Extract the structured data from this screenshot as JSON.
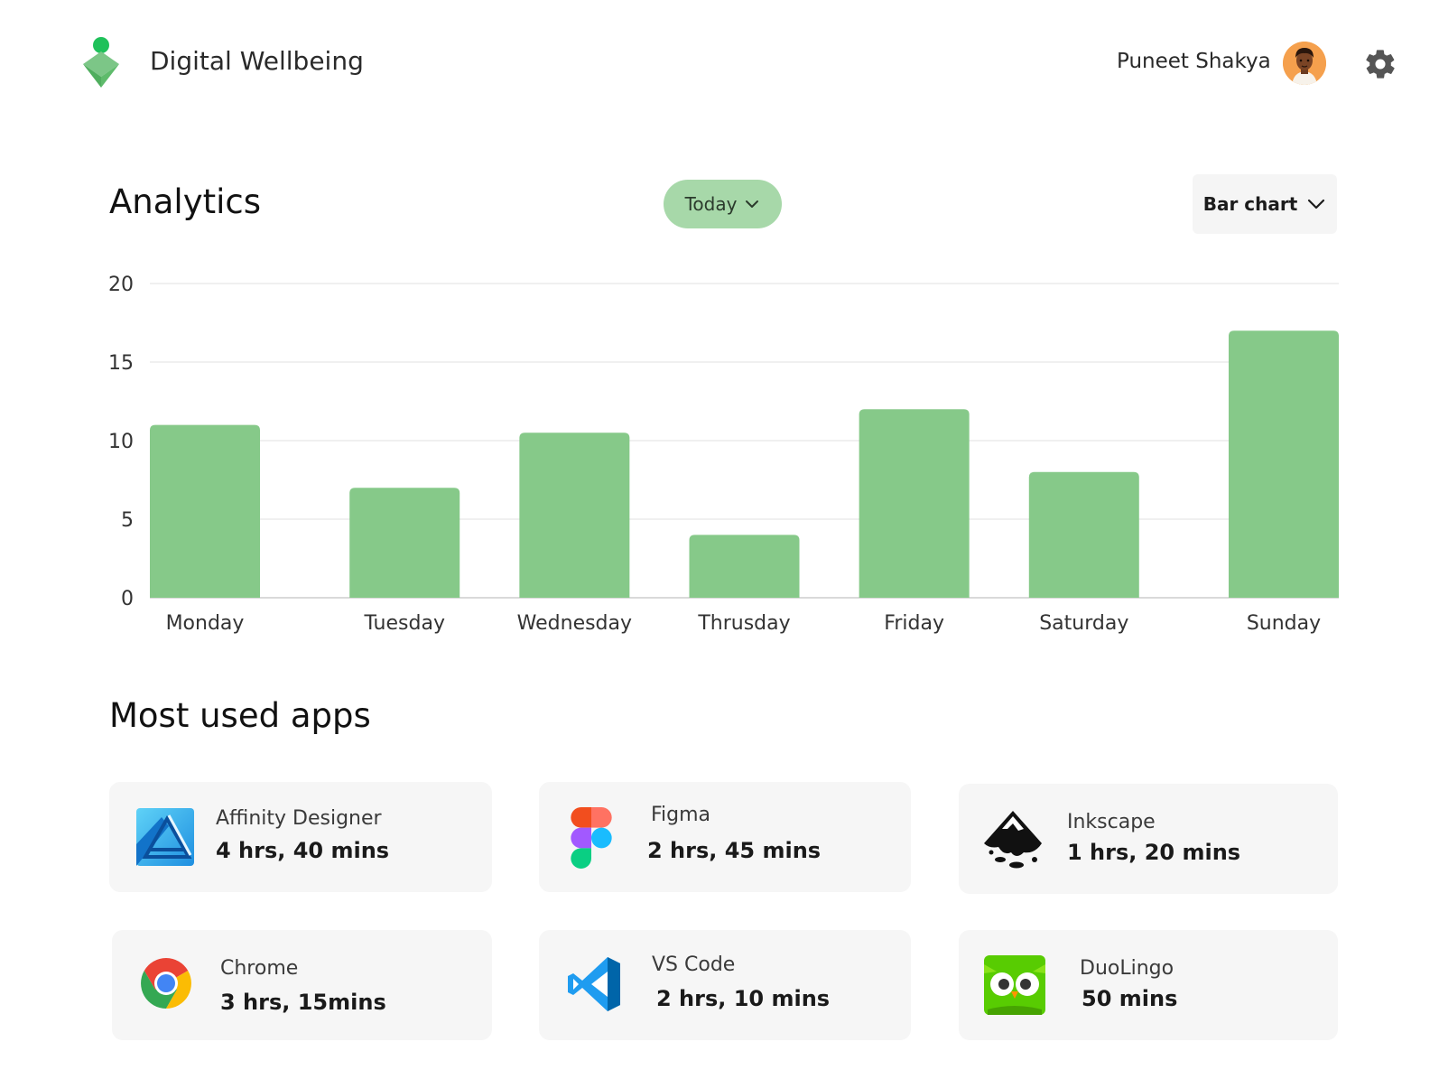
{
  "header": {
    "app_title": "Digital Wellbeing",
    "user_name": "Puneet Shakya"
  },
  "analytics": {
    "title": "Analytics",
    "period_label": "Today",
    "chart_type_label": "Bar chart"
  },
  "chart_data": {
    "type": "bar",
    "categories": [
      "Monday",
      "Tuesday",
      "Wednesday",
      "Thrusday",
      "Friday",
      "Saturday",
      "Sunday"
    ],
    "values": [
      11,
      7,
      10.5,
      4,
      12,
      8,
      17
    ],
    "ylim": [
      0,
      20
    ],
    "yticks": [
      0,
      5,
      10,
      15,
      20
    ],
    "grid": true,
    "bar_color": "#86c989"
  },
  "most_used": {
    "title": "Most used apps",
    "apps": [
      {
        "name": "Affinity Designer",
        "time": "4 hrs, 40 mins",
        "icon": "affinity-designer-icon"
      },
      {
        "name": "Figma",
        "time": "2 hrs, 45 mins",
        "icon": "figma-icon"
      },
      {
        "name": "Inkscape",
        "time": "1 hrs, 20 mins",
        "icon": "inkscape-icon"
      },
      {
        "name": "Chrome",
        "time": "3 hrs, 15mins",
        "icon": "chrome-icon"
      },
      {
        "name": "VS Code",
        "time": "2 hrs, 10 mins",
        "icon": "vscode-icon"
      },
      {
        "name": "DuoLingo",
        "time": "50 mins",
        "icon": "duolingo-icon"
      }
    ]
  },
  "colors": {
    "accent": "#86c989",
    "pill": "#a7d8a9",
    "card_bg": "#f6f6f6"
  }
}
